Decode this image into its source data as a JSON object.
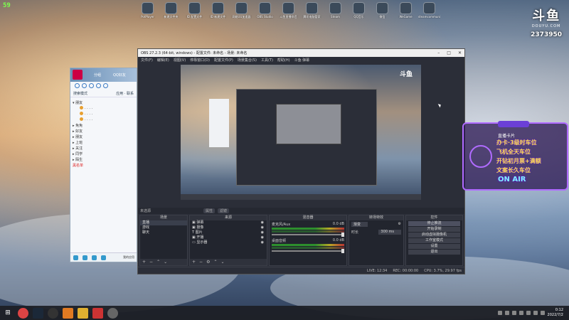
{
  "fps": "59",
  "brand": {
    "logo": "斗鱼",
    "domain": "DOUYU.COM",
    "room": "2373950"
  },
  "desktop_icons": [
    "PotPlayer",
    "新建文件夹",
    "ID 配置文件",
    "ID 新建文件",
    "网易UU加速器",
    "OBS Studio",
    "斗鱼直播伴侣",
    "腾讯电脑管家",
    "Steam",
    "QQ音乐",
    "微信",
    "WeGame",
    "steamcommunity"
  ],
  "qq": {
    "tab1": "分组",
    "tab2": "QQ好友",
    "search_label": "搜索模式",
    "search_right": "应用 · 联系",
    "groups": [
      {
        "label": "▾ 朋友",
        "friends": [
          "·  ·  ·  ·",
          "·  ·  ·  ·",
          "·  ·  ·  ·"
        ]
      },
      {
        "label": "▸ 免免"
      },
      {
        "label": "▸ 好友"
      },
      {
        "label": "▸ 朋友"
      },
      {
        "label": "▸ 上班"
      },
      {
        "label": "▸ 关注"
      },
      {
        "label": "▸ 同学"
      },
      {
        "label": "▸ 陌生"
      }
    ],
    "blacklist": "黑名单",
    "footer_label": "我的应用"
  },
  "obs": {
    "title": "OBS 27.2.3 (64-bit, windows) - 配置文件: 未命名 - 场景: 未命名",
    "window_buttons": [
      "–",
      "□",
      "✕"
    ],
    "menu": [
      "文件(F)",
      "编辑(E)",
      "视图(V)",
      "停靠窗口(D)",
      "配置文件(P)",
      "场景集合(S)",
      "工具(T)",
      "帮助(H)",
      "斗鱼·弹幕"
    ],
    "preview_logo": "斗鱼",
    "scene_label": "未选源",
    "props_btn": "属性",
    "filter_btn": "滤镜",
    "docks": {
      "scenes": {
        "title": "场景",
        "items": [
          "直播",
          "游戏",
          "聊天"
        ]
      },
      "sources": {
        "title": "来源",
        "items": [
          "弹幕",
          "摄像",
          "图片",
          "开播",
          "显示器"
        ]
      },
      "mixer": {
        "title": "混音器",
        "channels": [
          {
            "name": "麦克风/Aux",
            "db": "0.0 dB"
          },
          {
            "name": "桌面音频",
            "db": "0.0 dB"
          }
        ]
      },
      "transitions": {
        "title": "转场特效",
        "type": "渐变",
        "duration_label": "时长",
        "duration": "300 ms"
      },
      "controls": {
        "title": "控件",
        "buttons": [
          "停止推流",
          "开始录制",
          "启动虚拟摄像机",
          "工作室模式",
          "设置",
          "退出"
        ]
      }
    },
    "status": [
      "LIVE: 12:34",
      "REC: 00:00:00",
      "CPU: 3.7%, 29.97 fps"
    ]
  },
  "overlay": {
    "header": "直播卡片",
    "lines": [
      "办卡·3级时车位",
      "飞机全天车位",
      "开钻初月票+满额",
      "文案长久车位"
    ],
    "onair": "ON AIR"
  },
  "taskbar": {
    "start": "⊞",
    "clock_time": "0:12",
    "clock_date": "2022/7/2"
  }
}
